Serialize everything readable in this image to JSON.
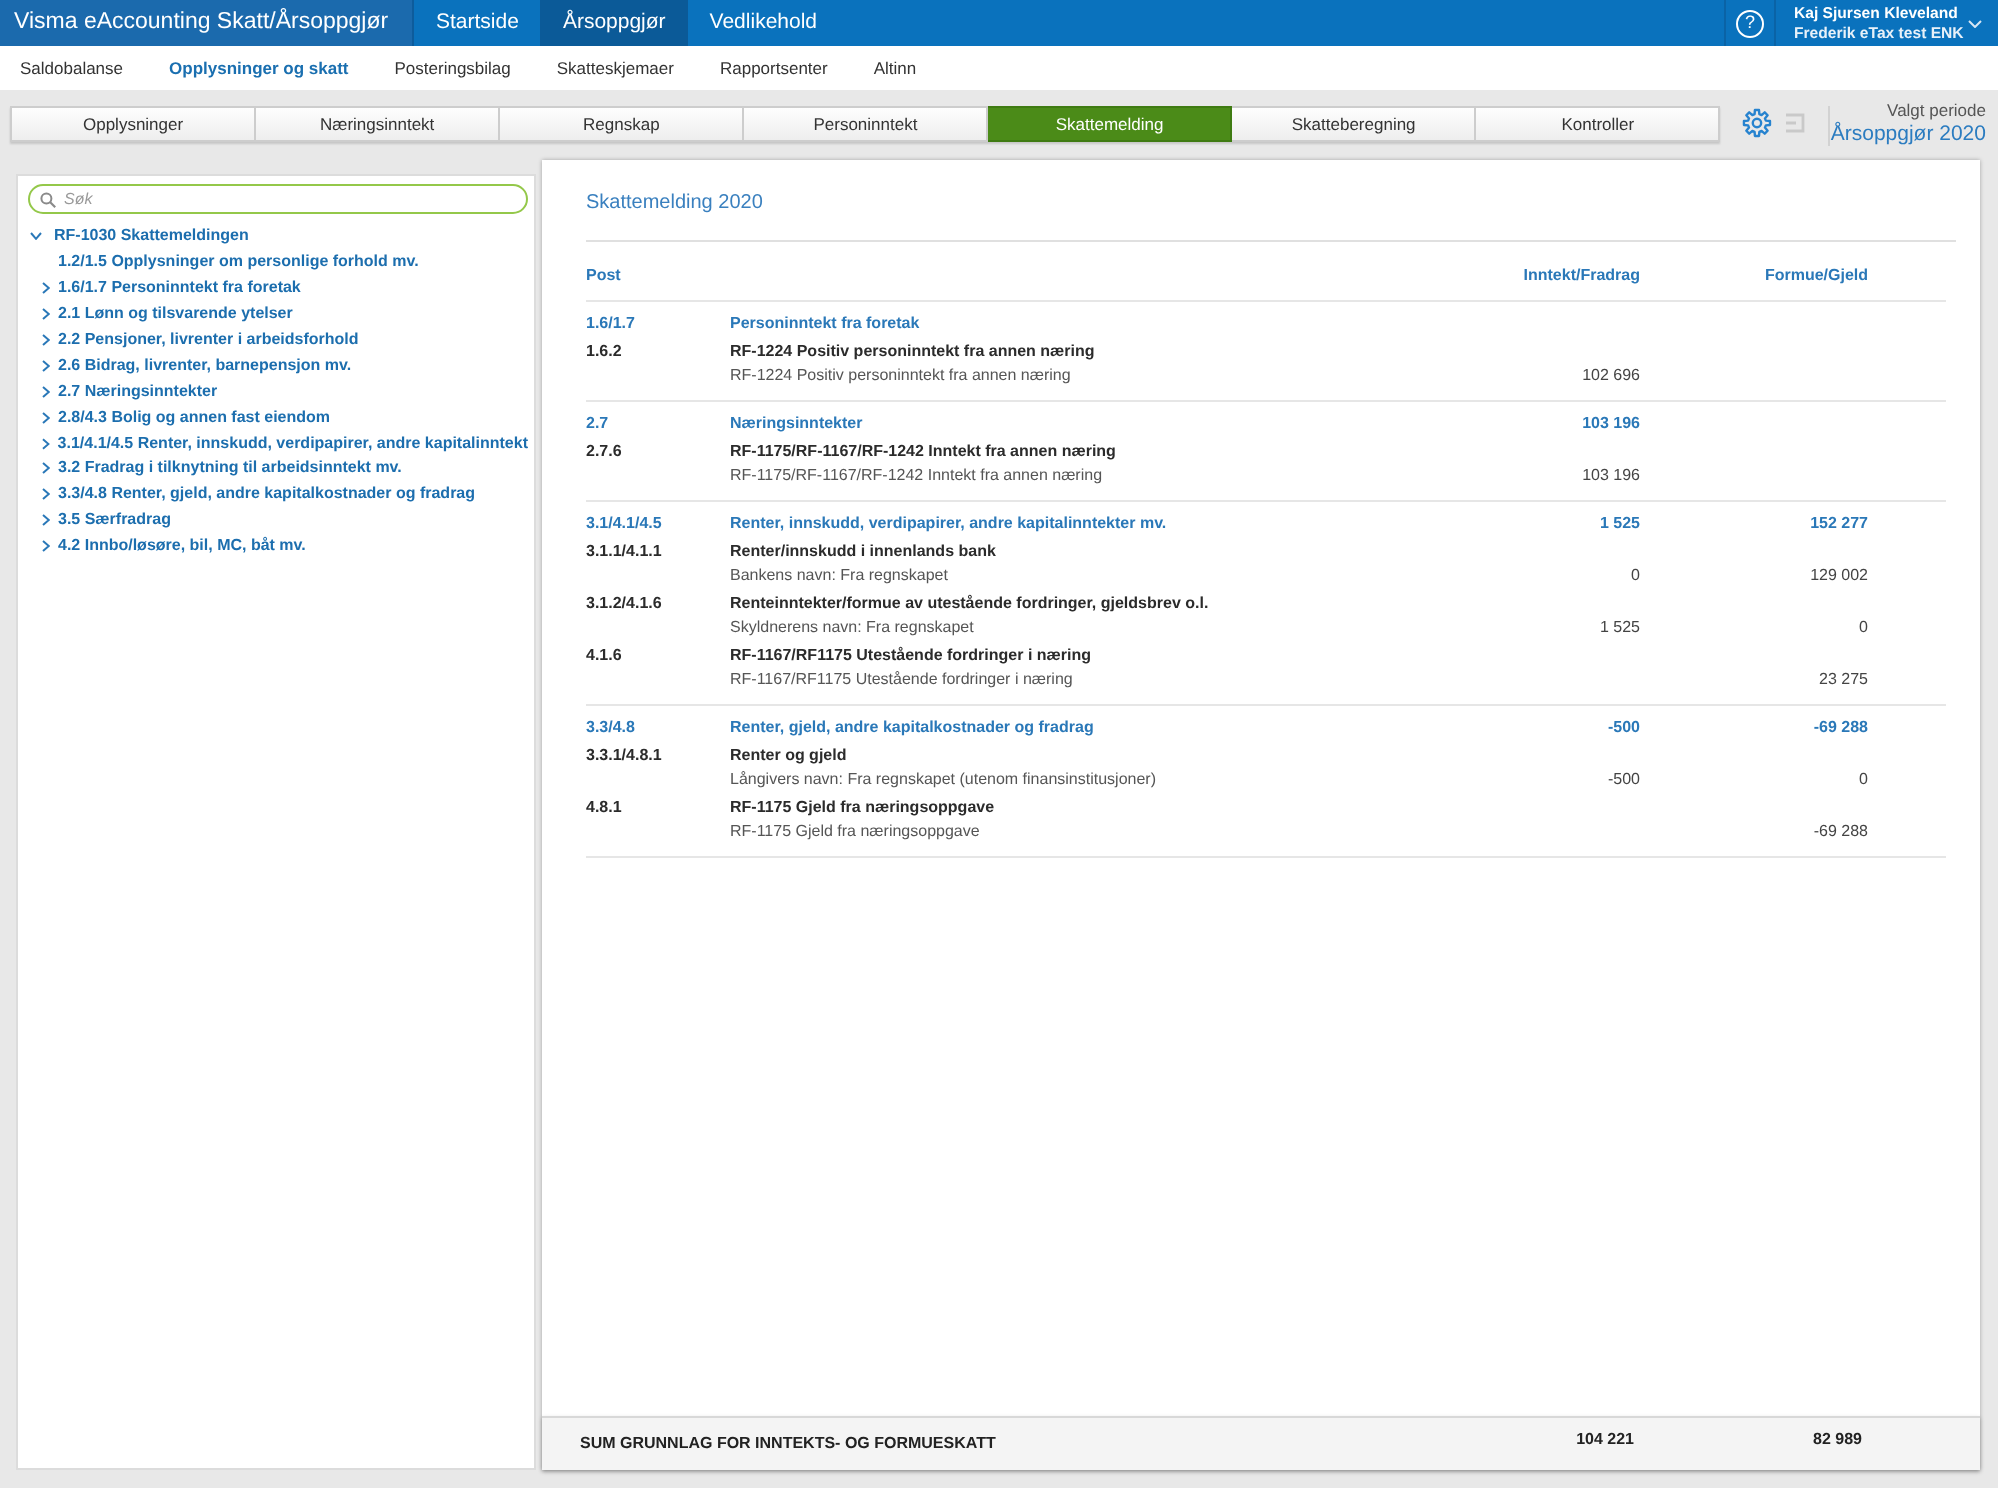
{
  "app_bar": {
    "title": "Visma eAccounting Skatt/Årsoppgjør",
    "menu": [
      {
        "label": "Startside",
        "selected": false
      },
      {
        "label": "Årsoppgjør",
        "selected": true
      },
      {
        "label": "Vedlikehold",
        "selected": false
      }
    ],
    "help": "?",
    "user": {
      "name": "Kaj Sjursen Kleveland",
      "company": "Frederik eTax test ENK"
    }
  },
  "sub_nav": [
    {
      "label": "Saldobalanse",
      "selected": false
    },
    {
      "label": "Opplysninger og skatt",
      "selected": true
    },
    {
      "label": "Posteringsbilag",
      "selected": false
    },
    {
      "label": "Skatteskjemaer",
      "selected": false
    },
    {
      "label": "Rapportsenter",
      "selected": false
    },
    {
      "label": "Altinn",
      "selected": false
    }
  ],
  "tabs": [
    {
      "label": "Opplysninger",
      "selected": false
    },
    {
      "label": "Næringsinntekt",
      "selected": false
    },
    {
      "label": "Regnskap",
      "selected": false
    },
    {
      "label": "Personinntekt",
      "selected": false
    },
    {
      "label": "Skattemelding",
      "selected": true
    },
    {
      "label": "Skatteberegning",
      "selected": false
    },
    {
      "label": "Kontroller",
      "selected": false
    }
  ],
  "toolbar": {
    "buttons": [
      {
        "kind": "settings",
        "disabled": false
      },
      {
        "kind": "panel",
        "disabled": true
      }
    ],
    "period_label": "Valgt periode",
    "period": "Årsoppgjør 2020"
  },
  "sidebar": {
    "search": {
      "placeholder": "Søk"
    },
    "tree": [
      {
        "label": "RF-1030 Skattemeldingen",
        "kind": "branch",
        "expanded": true,
        "children": [
          {
            "label": "1.2/1.5 Opplysninger om personlige forhold mv.",
            "kind": "leaf"
          },
          {
            "label": "1.6/1.7 Personinntekt fra foretak",
            "kind": "branch",
            "expanded": false
          },
          {
            "label": "2.1 Lønn og tilsvarende ytelser",
            "kind": "branch",
            "expanded": false
          },
          {
            "label": "2.2 Pensjoner, livrenter i arbeidsforhold",
            "kind": "branch",
            "expanded": false
          },
          {
            "label": "2.6 Bidrag, livrenter, barnepensjon mv.",
            "kind": "branch",
            "expanded": false
          },
          {
            "label": "2.7 Næringsinntekter",
            "kind": "branch",
            "expanded": false
          },
          {
            "label": "2.8/4.3 Bolig og annen fast eiendom",
            "kind": "branch",
            "expanded": false
          },
          {
            "label": "3.1/4.1/4.5 Renter, innskudd, verdipapirer, andre kapitalinntekt",
            "kind": "branch",
            "expanded": false
          },
          {
            "label": "3.2 Fradrag i tilknytning til arbeidsinntekt mv.",
            "kind": "branch",
            "expanded": false
          },
          {
            "label": "3.3/4.8 Renter, gjeld, andre kapitalkostnader og fradrag",
            "kind": "branch",
            "expanded": false
          },
          {
            "label": "3.5 Særfradrag",
            "kind": "branch",
            "expanded": false
          },
          {
            "label": "4.2 Innbo/løsøre, bil, MC, båt mv.",
            "kind": "branch",
            "expanded": false
          }
        ]
      }
    ]
  },
  "report": {
    "title": "Skattemelding 2020",
    "columns": [
      "Post",
      "Inntekt/Fradrag",
      "Formue/Gjeld"
    ],
    "sections": [
      {
        "code": "1.6/1.7",
        "title": "Personinntekt fra foretak",
        "items": [
          {
            "code": "1.6.2",
            "title": "RF-1224 Positiv personinntekt fra annen næring",
            "description": "RF-1224 Positiv personinntekt fra annen næring",
            "income": "102 696"
          }
        ]
      },
      {
        "code": "2.7",
        "title": "Næringsinntekter",
        "income": "103 196",
        "items": [
          {
            "code": "2.7.6",
            "title": "RF-1175/RF-1167/RF-1242 Inntekt fra annen næring",
            "description": "RF-1175/RF-1167/RF-1242 Inntekt fra annen næring",
            "income": "103 196"
          }
        ]
      },
      {
        "code": "3.1/4.1/4.5",
        "title": "Renter, innskudd, verdipapirer, andre kapitalinntekter mv.",
        "income": "1 525",
        "wealth": "152 277",
        "items": [
          {
            "code": "3.1.1/4.1.1",
            "title": "Renter/innskudd i innenlands bank",
            "description": "Bankens navn: Fra regnskapet",
            "income": "0",
            "wealth": "129 002"
          },
          {
            "code": "3.1.2/4.1.6",
            "title": "Renteinntekter/formue av utestående fordringer, gjeldsbrev o.l.",
            "description": "Skyldnerens navn: Fra regnskapet",
            "income": "1 525",
            "wealth": "0"
          },
          {
            "code": "4.1.6",
            "title": "RF-1167/RF1175 Utestående fordringer i næring",
            "description": "RF-1167/RF1175 Utestående fordringer i næring",
            "wealth": "23 275"
          }
        ]
      },
      {
        "code": "3.3/4.8",
        "title": "Renter, gjeld, andre kapitalkostnader og fradrag",
        "income": "-500",
        "wealth": "-69 288",
        "items": [
          {
            "code": "3.3.1/4.8.1",
            "title": "Renter og gjeld",
            "description": "Långivers navn: Fra regnskapet (utenom finansinstitusjoner)",
            "income": "-500",
            "wealth": "0"
          },
          {
            "code": "4.8.1",
            "title": "RF-1175 Gjeld fra næringsoppgave",
            "description": "RF-1175 Gjeld fra næringsoppgave",
            "wealth": "-69 288"
          }
        ]
      }
    ],
    "total": {
      "label": "SUM GRUNNLAG FOR INNTEKTS- OG FORMUESKATT",
      "income": "104 221",
      "wealth": "82 989"
    }
  }
}
